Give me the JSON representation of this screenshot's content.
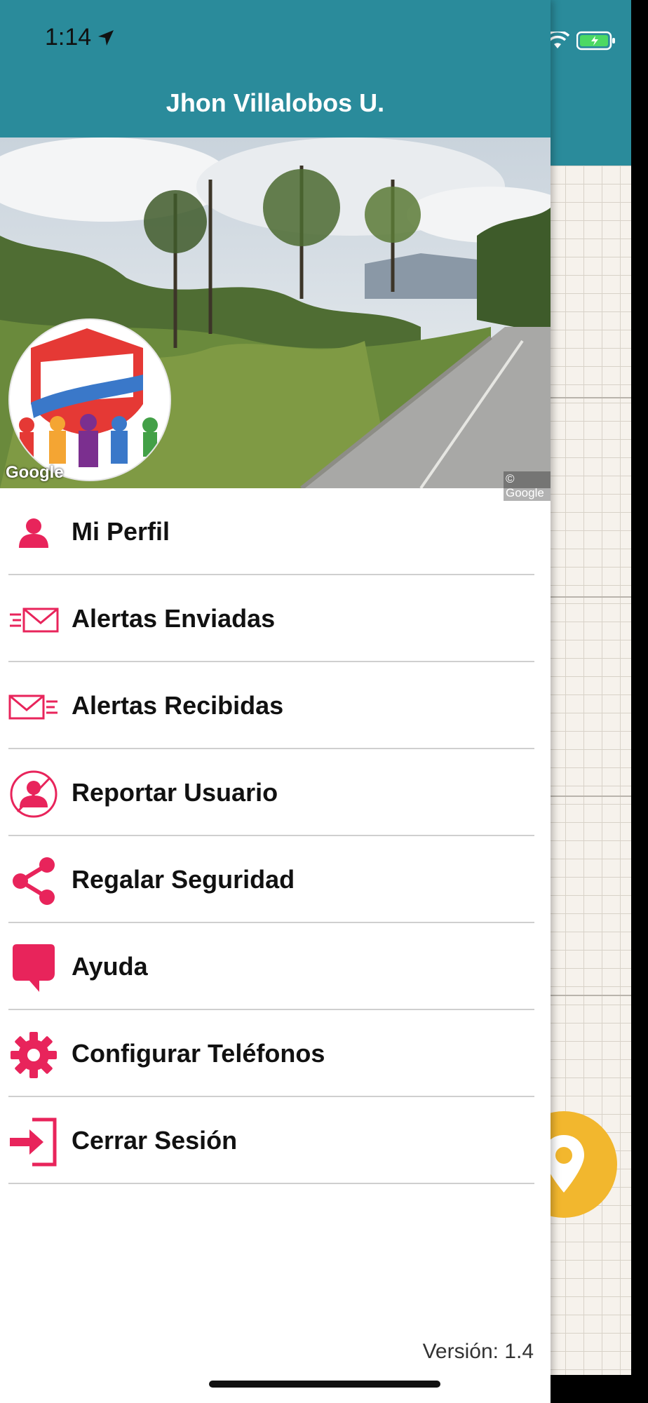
{
  "status_bar": {
    "time": "1:14"
  },
  "drawer": {
    "user_name": "Jhon Villalobos U.",
    "cover_watermark_left": "Google",
    "cover_watermark_right": "© Google",
    "menu": [
      {
        "label": "Mi Perfil",
        "icon": "user-icon"
      },
      {
        "label": "Alertas Enviadas",
        "icon": "sent-mail-icon"
      },
      {
        "label": "Alertas Recibidas",
        "icon": "received-mail-icon"
      },
      {
        "label": "Reportar Usuario",
        "icon": "report-user-icon"
      },
      {
        "label": "Regalar Seguridad",
        "icon": "share-icon"
      },
      {
        "label": "Ayuda",
        "icon": "chat-bubble-icon"
      },
      {
        "label": "Configurar Teléfonos",
        "icon": "gear-icon"
      },
      {
        "label": "Cerrar Sesión",
        "icon": "logout-icon"
      }
    ],
    "version": "Versión: 1.4"
  },
  "colors": {
    "header_teal": "#2a8b9b",
    "icon_pink": "#e8245b",
    "fab_yellow": "#f2b72e"
  }
}
